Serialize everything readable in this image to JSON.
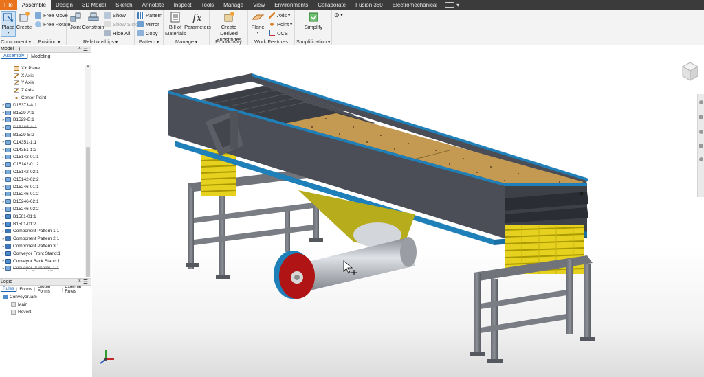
{
  "tabs": [
    "File",
    "Assemble",
    "Design",
    "3D Model",
    "Sketch",
    "Annotate",
    "Inspect",
    "Tools",
    "Manage",
    "View",
    "Environments",
    "Collaborate",
    "Fusion 360",
    "Electromechanical"
  ],
  "active_tab": "Assemble",
  "ribbon": {
    "component": {
      "label": "Component",
      "place": "Place",
      "create": "Create"
    },
    "position": {
      "label": "Position",
      "free_move": "Free Move",
      "free_rotate": "Free Rotate"
    },
    "relationships": {
      "label": "Relationships",
      "joint": "Joint",
      "constrain": "Constrain",
      "show": "Show",
      "show_sick": "Show Sick",
      "hide_all": "Hide All"
    },
    "pattern": {
      "label": "Pattern",
      "pattern": "Pattern",
      "mirror": "Mirror",
      "copy": "Copy"
    },
    "manage": {
      "label": "Manage",
      "bom": "Bill of Materials",
      "parameters": "Parameters"
    },
    "productivity": {
      "label": "Productivity",
      "create_derived": "Create Derived Substitutes"
    },
    "work_features": {
      "label": "Work Features",
      "plane": "Plane",
      "axis": "Axis",
      "point": "Point",
      "ucs": "UCS"
    },
    "simplification": {
      "label": "Simplification",
      "simplify": "Simplify"
    }
  },
  "browser": {
    "title": "Model",
    "tabs": [
      "Assembly",
      "Modeling"
    ],
    "items": [
      {
        "label": "XY Plane",
        "type": "plane",
        "struck": false,
        "indent": 2
      },
      {
        "label": "X Axis",
        "type": "axis",
        "struck": false,
        "indent": 2
      },
      {
        "label": "Y Axis",
        "type": "axis",
        "struck": false,
        "indent": 2
      },
      {
        "label": "Z Axis",
        "type": "axis",
        "struck": false,
        "indent": 2
      },
      {
        "label": "Center Point",
        "type": "point",
        "struck": false,
        "indent": 2
      },
      {
        "label": "D15373-A:1",
        "type": "part",
        "struck": false,
        "indent": 0
      },
      {
        "label": "B1529-A:1",
        "type": "part",
        "struck": false,
        "indent": 0
      },
      {
        "label": "B1529-B:1",
        "type": "part",
        "struck": false,
        "indent": 0
      },
      {
        "label": "D15185-A:1",
        "type": "part",
        "struck": true,
        "indent": 0
      },
      {
        "label": "B1529-B:2",
        "type": "part",
        "struck": false,
        "indent": 0
      },
      {
        "label": "C14351-1:1",
        "type": "part",
        "struck": false,
        "indent": 0
      },
      {
        "label": "C14351-1:2",
        "type": "part",
        "struck": false,
        "indent": 0
      },
      {
        "label": "C15142-01:1",
        "type": "part",
        "struck": false,
        "indent": 0
      },
      {
        "label": "C15142-01:2",
        "type": "part",
        "struck": false,
        "indent": 0
      },
      {
        "label": "C15142-02:1",
        "type": "part",
        "struck": false,
        "indent": 0
      },
      {
        "label": "C15142-02:2",
        "type": "part",
        "struck": false,
        "indent": 0
      },
      {
        "label": "D15246-01:1",
        "type": "part",
        "struck": false,
        "indent": 0
      },
      {
        "label": "D15246-01:2",
        "type": "part",
        "struck": false,
        "indent": 0
      },
      {
        "label": "D15246-02:1",
        "type": "part",
        "struck": false,
        "indent": 0
      },
      {
        "label": "D15246-02:2",
        "type": "part",
        "struck": false,
        "indent": 0
      },
      {
        "label": "B1501-01:1",
        "type": "asm",
        "struck": false,
        "indent": 0
      },
      {
        "label": "B1501-01:2",
        "type": "asm",
        "struck": false,
        "indent": 0
      },
      {
        "label": "Component Pattern 1:1",
        "type": "pattern",
        "struck": false,
        "indent": 0
      },
      {
        "label": "Component Pattern 2:1",
        "type": "pattern",
        "struck": false,
        "indent": 0
      },
      {
        "label": "Component Pattern 3:1",
        "type": "pattern",
        "struck": false,
        "indent": 0
      },
      {
        "label": "Conveyor Front Stand:1",
        "type": "asm",
        "struck": false,
        "indent": 0
      },
      {
        "label": "Conveyor Back Stand:1",
        "type": "asm",
        "struck": false,
        "indent": 0
      },
      {
        "label": "Conveyor_Simplify_1:1",
        "type": "part",
        "struck": true,
        "indent": 0
      }
    ]
  },
  "logic": {
    "title": "Logic",
    "tabs": [
      "Rules",
      "Forms",
      "Global Forms",
      "External Rules"
    ],
    "items": [
      {
        "label": "Conveyor.iam",
        "indent": 0
      },
      {
        "label": "Main",
        "indent": 1
      },
      {
        "label": "Revert",
        "indent": 1
      }
    ]
  },
  "colors": {
    "file_tab": "#e8731a",
    "accent": "#1a64b4",
    "frame": "#4a4d55",
    "trim": "#1f7fb8",
    "spring": "#e6d21e",
    "deck": "#c49a52",
    "bracket": "#b7ad1c",
    "pulley_red": "#b01414"
  }
}
